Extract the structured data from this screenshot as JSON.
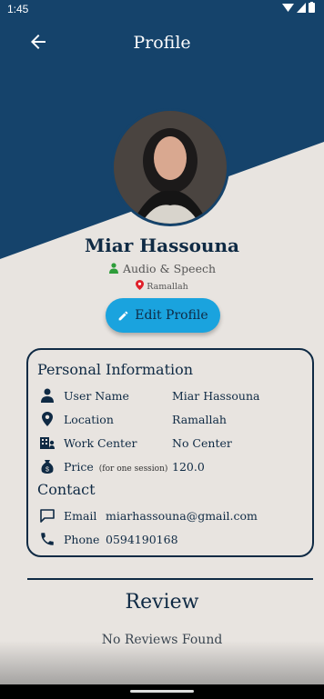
{
  "status_bar": {
    "time": "1:45"
  },
  "app_bar": {
    "title": "Profile"
  },
  "profile": {
    "name": "Miar Hassouna",
    "specialty": "Audio & Speech",
    "city": "Ramallah",
    "edit_label": "Edit Profile"
  },
  "personal": {
    "title": "Personal Information",
    "rows": [
      {
        "label": "User Name",
        "value": "Miar Hassouna",
        "icon": "person-icon"
      },
      {
        "label": "Location",
        "value": "Ramallah",
        "icon": "location-pin-icon"
      },
      {
        "label": "Work Center",
        "value": "No Center",
        "icon": "building-icon"
      },
      {
        "label": "Price",
        "note": "(for one session)",
        "value": "120.0",
        "icon": "money-bag-icon"
      }
    ]
  },
  "contact": {
    "title": "Contact",
    "email_label": "Email",
    "email": "miarhassouna@gmail.com",
    "phone_label": "Phone",
    "phone": "0594190168"
  },
  "review": {
    "title": "Review",
    "empty_text": "No Reviews Found"
  },
  "colors": {
    "primary": "#15436b",
    "accent": "#1aa3de",
    "background": "#e8e4e0",
    "pin": "#e0202a",
    "specialty_icon": "#2e9d3a"
  }
}
